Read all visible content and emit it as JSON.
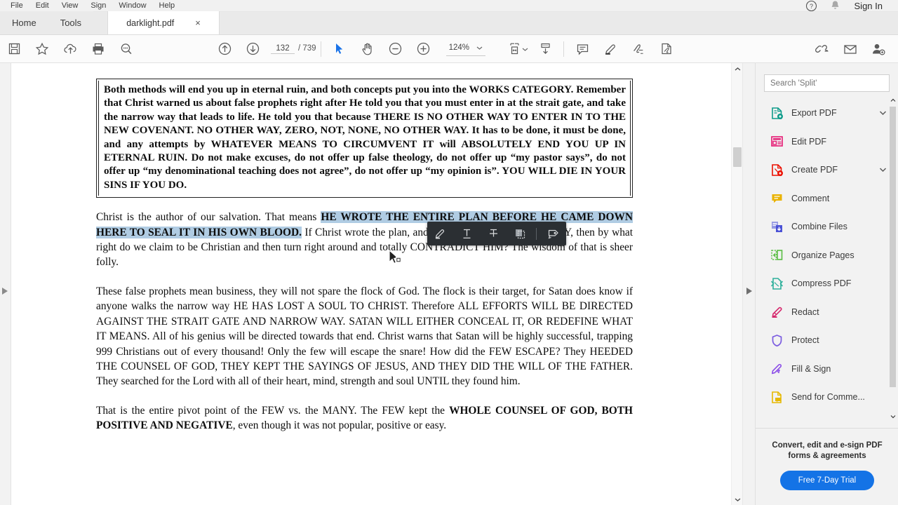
{
  "menu": {
    "items": [
      "File",
      "Edit",
      "View",
      "Sign",
      "Window",
      "Help"
    ],
    "help_icon": "help-circle-icon",
    "bell_icon": "notification-bell-icon",
    "sign_in": "Sign In"
  },
  "tabs": {
    "home": "Home",
    "tools": "Tools",
    "document": "darklight.pdf",
    "close": "×"
  },
  "toolbar": {
    "save_icon": "save-icon",
    "star_icon": "star-icon",
    "cloud_icon": "cloud-upload-icon",
    "print_icon": "print-icon",
    "search_icon": "search-icon",
    "prev_page_icon": "page-up-icon",
    "next_page_icon": "page-down-icon",
    "page_current": "132",
    "page_total": "/ 739",
    "select_icon": "select-cursor-icon",
    "hand_icon": "hand-tool-icon",
    "zoom_out_icon": "zoom-out-icon",
    "zoom_in_icon": "zoom-in-icon",
    "zoom_value": "124%",
    "zoom_dropdown_icon": "chevron-down-icon",
    "fit_width_icon": "fit-width-icon",
    "fit_dropdown_icon": "chevron-down-icon",
    "scroll_mode_icon": "scroll-mode-icon",
    "comment_icon": "comment-icon",
    "highlight_icon": "highlight-marker-icon",
    "sign_icon": "sign-icon",
    "fill_sign_icon": "fill-and-sign-icon",
    "share_link_icon": "share-link-icon",
    "email_icon": "email-icon",
    "add_person_icon": "add-person-icon"
  },
  "document": {
    "box_paragraph": "Both methods will end you up in eternal ruin, and both concepts put you into the WORKS CATEGORY. Remember that Christ warned us about false prophets right after He told you that you must enter in at the strait gate, and take the narrow way that leads to life. He told you that because THERE IS NO OTHER WAY TO ENTER IN TO THE NEW COVENANT. NO OTHER WAY, ZERO, NOT, NONE, NO OTHER WAY. It has to be done, it must be done, and any attempts by WHATEVER MEANS TO CIRCUMVENT IT will ABSOLUTELY END YOU UP IN ETERNAL RUIN. Do not make excuses, do not offer up false theology, do not offer up “my pastor says”, do not offer up “my denominational teaching does not agree”, do not offer up “my opinion is”. YOU WILL DIE IN YOUR SINS IF YOU DO.",
    "para2_lead": "Christ is the author of our salvation. That means ",
    "para2_selected": "HE WROTE THE ENTIRE PLAN BEFORE HE CAME DOWN HERE TO SEAL IT IN HIS OWN BLOOD.",
    "para2_tail": " If Christ wrote the plan, and He is our FINAL AUTHORITY, then by what right do we claim to be Christian and then turn right around and totally CONTRADICT HIM? The wisdom of that is sheer folly.",
    "para3": "These false prophets mean business, they will not spare the flock of God. The flock is their target, for Satan does know if anyone walks the narrow way HE HAS LOST A SOUL TO CHRIST. Therefore ALL EFFORTS WILL BE DIRECTED AGAINST THE STRAIT GATE AND NARROW WAY. SATAN WILL EITHER CONCEAL IT, OR REDEFINE WHAT IT MEANS. All of his genius will be directed towards that end. Christ warns that Satan will be highly successful, trapping 999 Christians out of every thousand! Only the few will escape the snare! How did the FEW ESCAPE? They HEEDED THE COUNSEL OF GOD, THEY KEPT THE SAYINGS OF JESUS, AND THEY DID THE WILL OF THE FATHER. They searched for the Lord with all of their heart, mind, strength and soul UNTIL they found him.",
    "para4_lead": "That is the entire pivot point of the FEW vs. the MANY. The FEW kept the ",
    "para4_bold": "WHOLE COUNSEL OF GOD, BOTH POSITIVE AND NEGATIVE",
    "para4_tail": ", even though it was not popular, positive or easy."
  },
  "annotation_popup": {
    "highlight_icon": "highlight-text-icon",
    "underline_icon": "underline-text-icon",
    "strikethrough_icon": "strikethrough-text-icon",
    "copy_icon": "copy-to-clipboard-icon",
    "note_icon": "add-sticky-note-icon"
  },
  "tools_panel": {
    "search_placeholder": "Search 'Split'",
    "items": [
      {
        "label": "Export PDF",
        "icon": "export-pdf-icon",
        "color": "#0e9b8a",
        "chevron": true
      },
      {
        "label": "Edit PDF",
        "icon": "edit-pdf-icon",
        "color": "#e6267a",
        "chevron": false
      },
      {
        "label": "Create PDF",
        "icon": "create-pdf-icon",
        "color": "#eb1000",
        "chevron": true
      },
      {
        "label": "Comment",
        "icon": "comment-icon",
        "color": "#e9b200",
        "chevron": false
      },
      {
        "label": "Combine Files",
        "icon": "combine-files-icon",
        "color": "#4b52d6",
        "chevron": false
      },
      {
        "label": "Organize Pages",
        "icon": "organize-pages-icon",
        "color": "#5fbf4a",
        "chevron": false
      },
      {
        "label": "Compress PDF",
        "icon": "compress-pdf-icon",
        "color": "#2eb09b",
        "chevron": false
      },
      {
        "label": "Redact",
        "icon": "redact-icon",
        "color": "#d62a6e",
        "chevron": false
      },
      {
        "label": "Protect",
        "icon": "protect-shield-icon",
        "color": "#7b5ce0",
        "chevron": false
      },
      {
        "label": "Fill & Sign",
        "icon": "fill-and-sign-icon",
        "color": "#8b4ce8",
        "chevron": false
      },
      {
        "label": "Send for Comme...",
        "icon": "send-comments-icon",
        "color": "#e6b800",
        "chevron": false
      }
    ],
    "promo_text": "Convert, edit and e-sign PDF forms & agreements",
    "trial_button": "Free 7-Day Trial",
    "trial_color": "#1473e6"
  }
}
